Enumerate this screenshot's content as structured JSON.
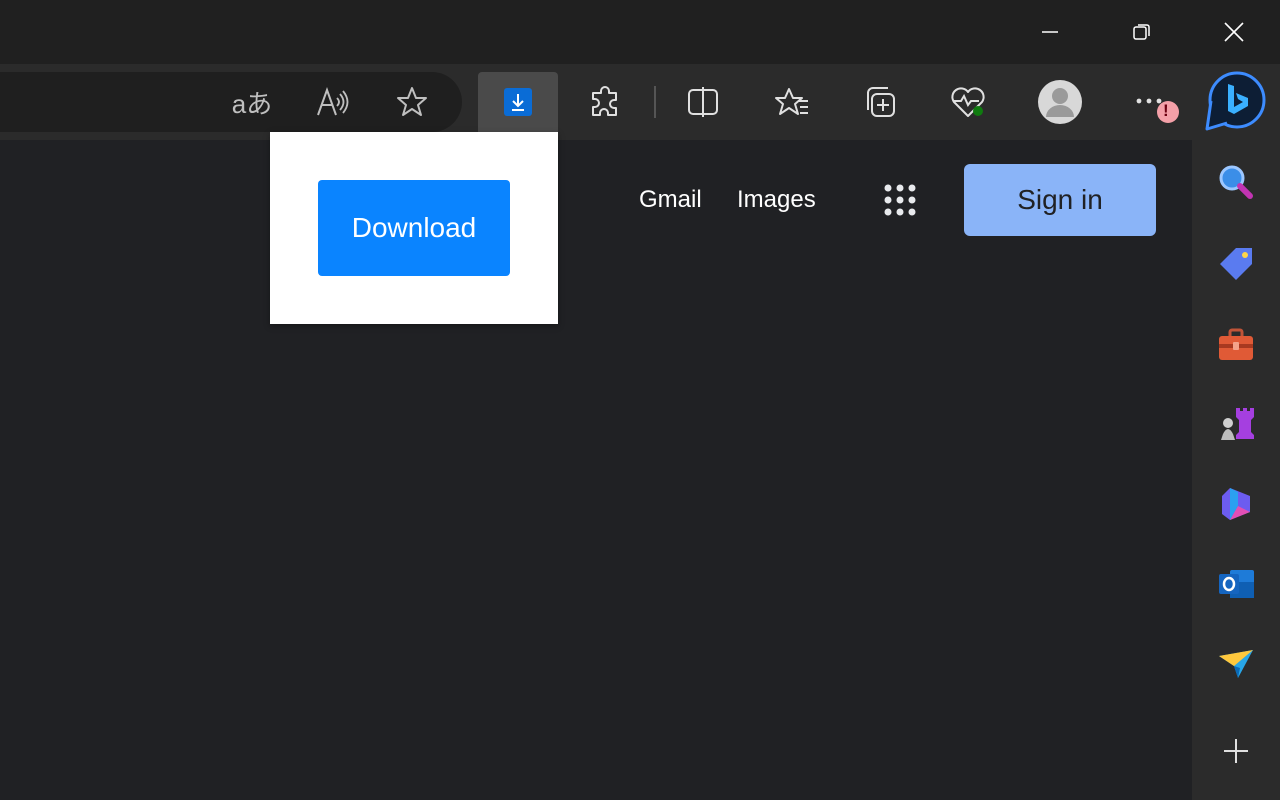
{
  "window": {
    "controls": [
      "minimize",
      "restore",
      "close"
    ]
  },
  "toolbar": {
    "icons": [
      "translate-icon",
      "read-aloud-icon",
      "favorite-star-icon",
      "download-icon",
      "extensions-icon",
      "split-screen-icon",
      "favorites-icon",
      "collections-icon",
      "browser-essentials-icon",
      "profile-avatar",
      "more-options-icon",
      "copilot-icon"
    ],
    "more_alert": "!",
    "translate_glyph": "aあ"
  },
  "popup": {
    "download_label": "Download"
  },
  "page": {
    "gmail_label": "Gmail",
    "images_label": "Images",
    "signin_label": "Sign in"
  },
  "sidebar": {
    "icons": [
      "search-icon",
      "shopping-icon",
      "tools-icon",
      "games-icon",
      "microsoft-365-icon",
      "outlook-icon",
      "drop-icon",
      "add-icon"
    ]
  },
  "colors": {
    "accent": "#0a84ff",
    "signin_bg": "#8ab4f8",
    "content_bg": "#202124",
    "toolbar_bg": "#2b2b2b",
    "titlebar_bg": "#202020"
  }
}
